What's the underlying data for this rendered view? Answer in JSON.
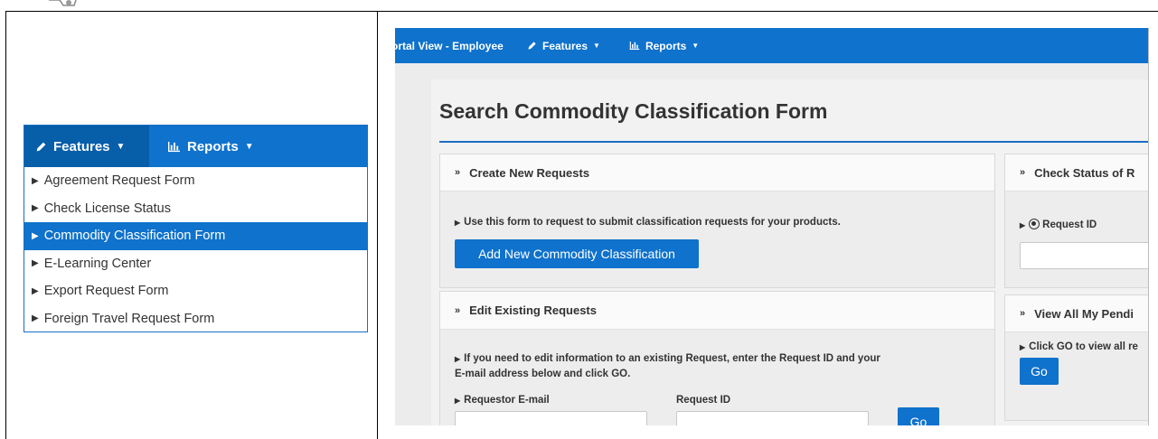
{
  "left_menu": {
    "bar": {
      "features_label": "Features",
      "reports_label": "Reports"
    },
    "items": [
      "Agreement Request Form",
      "Check License Status",
      "Commodity Classification Form",
      "E-Learning Center",
      "Export Request Form",
      "Foreign Travel Request Form"
    ],
    "selected_index": 2
  },
  "portal": {
    "nav": {
      "brand": "ortal View - Employee",
      "features_label": "Features",
      "reports_label": "Reports"
    },
    "page_title": "Search Commodity Classification Form",
    "create_card": {
      "heading": "Create New Requests",
      "note": "Use this form to request to submit classification requests for your products.",
      "button": "Add New Commodity Classification"
    },
    "edit_card": {
      "heading": "Edit Existing Requests",
      "note_line1": "If you need to edit information to an existing Request, enter the Request ID and your",
      "note_line2": "E-mail address below and click GO.",
      "email_label": "Requestor E-mail",
      "id_label": "Request ID",
      "go_button": "Go"
    },
    "status_card": {
      "heading": "Check Status of R",
      "radio_label": "Request ID"
    },
    "pending_card": {
      "heading": "View All My Pendi",
      "note": "Click GO to view all re",
      "go_button": "Go"
    }
  },
  "colors": {
    "primary": "#0f72cc",
    "primary_dark": "#075ea9",
    "page_bg": "#f2f2f2"
  }
}
